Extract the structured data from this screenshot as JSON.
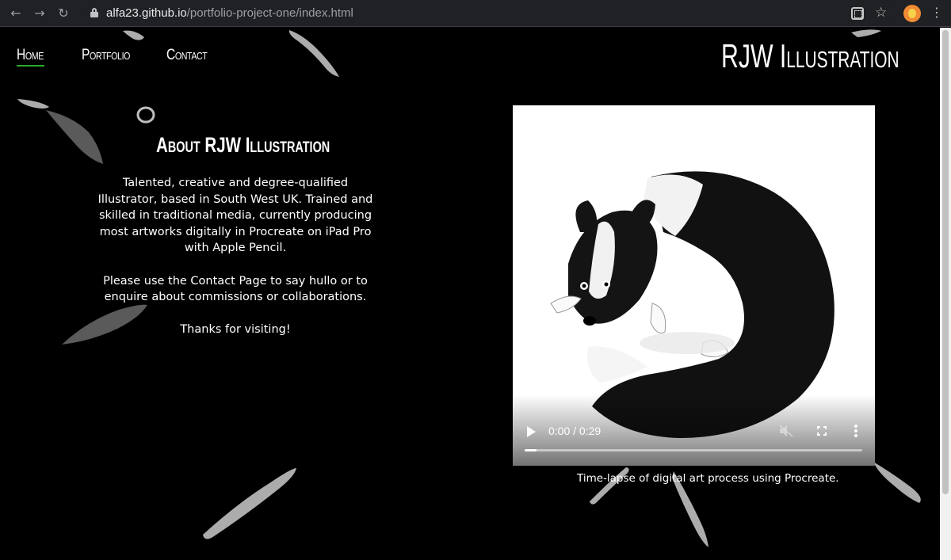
{
  "browser": {
    "url_host": "alfa23.github.io",
    "url_path": "/portfolio-project-one/index.html",
    "icons": [
      "back-icon",
      "forward-icon",
      "reload-icon",
      "lock-icon",
      "extension-icon",
      "star-icon",
      "profile-avatar",
      "kebab-menu-icon"
    ]
  },
  "nav": {
    "items": [
      {
        "label": "Home",
        "active": true
      },
      {
        "label": "Portfolio",
        "active": false
      },
      {
        "label": "Contact",
        "active": false
      }
    ],
    "active_color": "#2ca82c"
  },
  "brand": "RJW Illustration",
  "about": {
    "title": "About RJW Illustration",
    "paragraphs": [
      "Talented, creative and degree-qualified Illustrator, based in South West UK. Trained and skilled in traditional media, currently producing most artworks digitally in Procreate on iPad Pro with Apple Pencil.",
      "Please use the Contact Page to say hullo or to enquire about commissions or collaborations.",
      "Thanks for visiting!"
    ]
  },
  "video": {
    "time": "0:00 / 0:29",
    "progress": 0.035,
    "muted": true,
    "caption": "Time-lapse of digital art process using Procreate."
  }
}
